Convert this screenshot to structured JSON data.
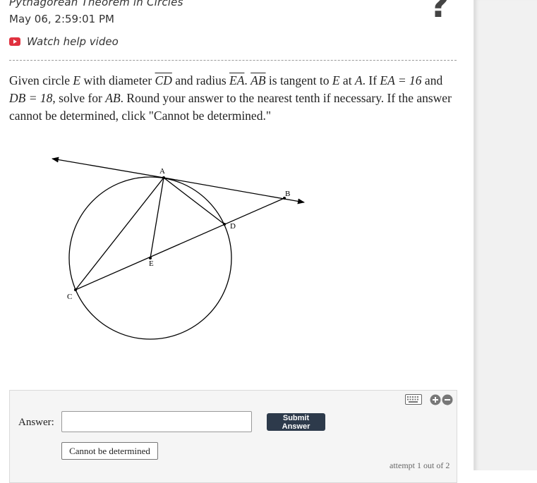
{
  "header": {
    "topic": "Pythagorean Theorem in Circles",
    "timestamp": "May 06, 2:59:01 PM",
    "help_video_label": "Watch help video",
    "help_icon": "?"
  },
  "question": {
    "t1": "Given circle ",
    "E1": "E",
    "t2": " with diameter ",
    "CD": "CD",
    "t3": " and radius ",
    "EA": "EA",
    "t4": ". ",
    "AB": "AB",
    "t5": " is tangent to ",
    "E2": "E",
    "t6": " at ",
    "A1": "A",
    "t7": ". If ",
    "eq1": "EA = 16",
    "t8": " and ",
    "eq2": "DB = 18",
    "t9": ", solve for ",
    "AB2": "AB",
    "t10": ". Round your answer to the nearest tenth if necessary. If the answer cannot be determined, click \"Cannot be determined.\""
  },
  "figure": {
    "labels": {
      "A": "A",
      "B": "B",
      "C": "C",
      "D": "D",
      "E": "E"
    }
  },
  "answer": {
    "label": "Answer:",
    "input_value": "",
    "input_placeholder": "",
    "submit_label": "Submit Answer",
    "cannot_label": "Cannot be determined",
    "attempt_text": "attempt 1 out of 2"
  },
  "colors": {
    "submit_bg": "#2d3a4b",
    "video_icon": "#e0313f",
    "sidebar_bg": "#f1f1f1"
  }
}
